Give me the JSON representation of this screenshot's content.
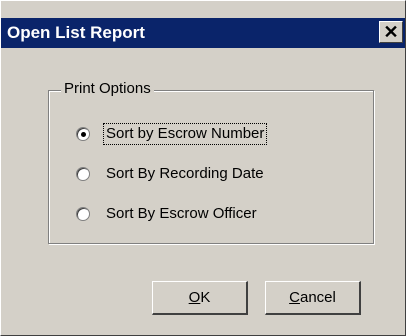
{
  "window": {
    "title": "Open List Report",
    "close_glyph": "✕"
  },
  "print_options": {
    "legend": "Print Options",
    "options": [
      {
        "label": "Sort by Escrow Number",
        "selected": true
      },
      {
        "label": "Sort By Recording Date",
        "selected": false
      },
      {
        "label": "Sort By Escrow Officer",
        "selected": false
      }
    ]
  },
  "buttons": {
    "ok_mnemonic": "O",
    "ok_rest": "K",
    "cancel_mnemonic": "C",
    "cancel_rest": "ancel"
  },
  "colors": {
    "titlebar": "#0a246a",
    "face": "#d4d0c8"
  }
}
